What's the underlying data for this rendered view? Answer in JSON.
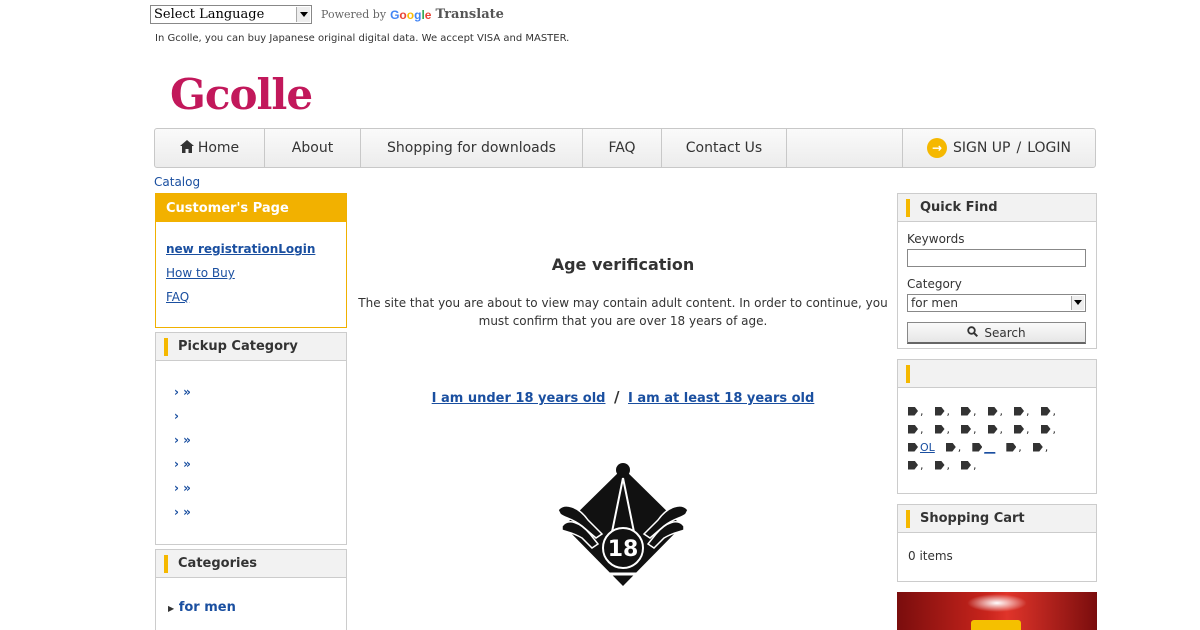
{
  "translate": {
    "select_label": "Select Language",
    "powered_by": "Powered by",
    "google": "Google",
    "translate_word": "Translate"
  },
  "tagline": "In Gcolle, you can buy Japanese original digital data. We accept VISA and MASTER.",
  "logo": "Gcolle",
  "nav": {
    "home": "Home",
    "about": "About",
    "shopping": "Shopping for downloads",
    "faq": "FAQ",
    "contact": "Contact Us",
    "signup": "SIGN UP",
    "slash": "/",
    "login": "LOGIN"
  },
  "breadcrumb": "Catalog",
  "customer_box": {
    "title": "Customer's Page",
    "new_registration": "new registration",
    "login": "Login",
    "how_to_buy": "How to Buy",
    "faq": "FAQ"
  },
  "pickup_box": {
    "title": "Pickup Category",
    "items": [
      "› »",
      "›",
      "› »",
      "› »",
      "› »",
      "› »"
    ]
  },
  "categories_box": {
    "title": "Categories",
    "first_item": "for men"
  },
  "age": {
    "title": "Age verification",
    "message": "The site that you are about to view may contain adult content. In order to continue, you must confirm that you are over 18 years of age.",
    "under_link": "I am under 18 years old",
    "separator": "/",
    "over_link": "I am at least 18 years old",
    "badge_number": "18"
  },
  "quick_find": {
    "title": "Quick Find",
    "keywords_label": "Keywords",
    "keywords_value": "",
    "category_label": "Category",
    "category_value": "for men",
    "search_button": "Search"
  },
  "tags_box": {
    "title": "",
    "rows": [
      [
        ",",
        ",",
        ",",
        ",",
        ",",
        ","
      ],
      [
        ",",
        ",",
        ",",
        ",",
        ",",
        ","
      ],
      [
        "OL",
        ",",
        "__",
        ",",
        ","
      ],
      [
        ",",
        ",",
        ","
      ]
    ]
  },
  "cart": {
    "title": "Shopping Cart",
    "count_text": "0 items"
  },
  "colors": {
    "accent": "#f2b100",
    "link": "#1a4fa0",
    "logo": "#c2185b"
  }
}
